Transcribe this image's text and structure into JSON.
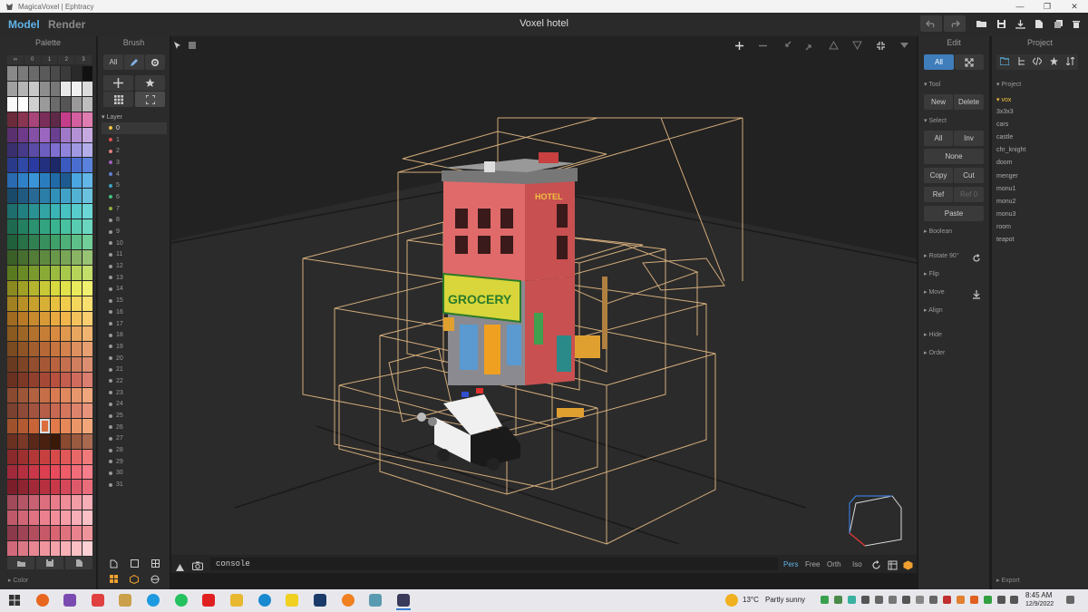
{
  "window": {
    "title": "MagicaVoxel | Ephtracy"
  },
  "header": {
    "mode_model": "Model",
    "mode_render": "Render",
    "doc_title": "Voxel hotel"
  },
  "palette": {
    "title": "Palette",
    "tabs": [
      "∞",
      "0",
      "1",
      "2",
      "3"
    ],
    "colors": [
      "#8a8a8a",
      "#7a7a7a",
      "#6a6a6a",
      "#5a5a5a",
      "#4a4a4a",
      "#3a3a3a",
      "#2a2a2a",
      "#111111",
      "#a0a0a0",
      "#b5b5b5",
      "#c8c8c8",
      "#8d8d8d",
      "#777777",
      "#e8e8e8",
      "#f0f0f0",
      "#dcdcdc",
      "#f8f8f8",
      "#ffffff",
      "#cfcfcf",
      "#9a9a9a",
      "#6b6b6b",
      "#555555",
      "#999999",
      "#bdbdbd",
      "#6b2b3b",
      "#8a3552",
      "#a8457a",
      "#7a2e5a",
      "#5e2948",
      "#c43d8a",
      "#d35f9e",
      "#e07db0",
      "#5a2f6e",
      "#6e3a8a",
      "#8450a6",
      "#9b66c0",
      "#6a3f90",
      "#a078c8",
      "#b491d4",
      "#c6a9e0",
      "#3a2f6e",
      "#483a8a",
      "#5a4ca6",
      "#6b5ec0",
      "#7e6fd0",
      "#8f84da",
      "#a098e2",
      "#b3aeea",
      "#2a3a8a",
      "#3048a6",
      "#2a3aa0",
      "#233080",
      "#1c2868",
      "#3a5ac0",
      "#4a6ed0",
      "#5a82dc",
      "#2a6ab0",
      "#3080c8",
      "#3a95d8",
      "#2a7ec0",
      "#206aa8",
      "#1e5a90",
      "#4aa6e0",
      "#62b6e8",
      "#1a4a6a",
      "#205a80",
      "#286a95",
      "#2a7ea8",
      "#3090b8",
      "#40a2c8",
      "#52b2d4",
      "#6ac2de",
      "#1e6e6e",
      "#238080",
      "#2a9292",
      "#32a4a4",
      "#3ab4b4",
      "#48c2c2",
      "#58cccc",
      "#6ad6d6",
      "#1e6a50",
      "#238060",
      "#2a9270",
      "#32a480",
      "#3ab490",
      "#48c2a0",
      "#58ccb0",
      "#6ad6c0",
      "#20603a",
      "#287046",
      "#308052",
      "#38905e",
      "#40a06a",
      "#4eb078",
      "#5ec088",
      "#70ce98",
      "#3a6028",
      "#466e30",
      "#527c38",
      "#5e8a40",
      "#6a984a",
      "#78a656",
      "#88b464",
      "#98c274",
      "#5a7a20",
      "#6a8a26",
      "#7a9a2e",
      "#8aaa36",
      "#9aba40",
      "#a8c84c",
      "#b6d45a",
      "#c4de6a",
      "#8a8a20",
      "#a0a026",
      "#b4b42e",
      "#c8c836",
      "#d8d840",
      "#e2e24c",
      "#eaea5c",
      "#f0f070",
      "#a08020",
      "#b89026",
      "#c8a02e",
      "#d8b036",
      "#e8c040",
      "#f0cc4c",
      "#f4d65c",
      "#f8e070",
      "#a06a20",
      "#b87a26",
      "#c88a2e",
      "#d89a36",
      "#e8aa40",
      "#f0b64c",
      "#f4c25c",
      "#f8ce70",
      "#8a5a20",
      "#9e6626",
      "#b2722e",
      "#c67e36",
      "#d88a40",
      "#e0984e",
      "#e8a65e",
      "#f0b470",
      "#7a4a20",
      "#8e5426",
      "#a25e2e",
      "#b66836",
      "#c87440",
      "#d4824e",
      "#de905e",
      "#e8a070",
      "#6a3a20",
      "#7e4426",
      "#924e2e",
      "#a65836",
      "#b86240",
      "#c4704e",
      "#d07e5e",
      "#dc8e70",
      "#6a3020",
      "#7e3826",
      "#92402e",
      "#a64836",
      "#b85040",
      "#c45e4e",
      "#d06c5e",
      "#dc7e70",
      "#8a4a30",
      "#9e5638",
      "#b26240",
      "#c66e48",
      "#d87a52",
      "#e0885e",
      "#e8966c",
      "#f0a67c",
      "#7a4030",
      "#8e4a38",
      "#a25440",
      "#b65e48",
      "#c86852",
      "#d4765e",
      "#de846c",
      "#e8947c",
      "#a0522d",
      "#b45a32",
      "#c86438",
      "#dc6e3e",
      "#e07a4a",
      "#e68858",
      "#ec9668",
      "#f2a67a",
      "#6a3020",
      "#7a3826",
      "#5a2818",
      "#4a2010",
      "#3a1808",
      "#8a4a30",
      "#9a5a40",
      "#aa6a50",
      "#8a2a2a",
      "#9e3030",
      "#b23838",
      "#c64040",
      "#d84a4a",
      "#e05858",
      "#e86868",
      "#f07a7a",
      "#a02a3a",
      "#b43040",
      "#c83848",
      "#dc4050",
      "#e84c5c",
      "#ee5c6a",
      "#f26c7a",
      "#f67e8a",
      "#7a1e2a",
      "#8e2430",
      "#a22a38",
      "#b63040",
      "#c83848",
      "#d4485a",
      "#de5a6a",
      "#e86c7a",
      "#a04a5a",
      "#b45666",
      "#c86272",
      "#dc6e7e",
      "#e87c8a",
      "#ee8c98",
      "#f29ca6",
      "#f6aeb6",
      "#c05a6a",
      "#d06676",
      "#e07282",
      "#ec808e",
      "#f28e9a",
      "#f69ea8",
      "#f8aeb6",
      "#fac0c6",
      "#8a3a4a",
      "#9e4454",
      "#b24e5e",
      "#c65868",
      "#d86472",
      "#e0727e",
      "#e8828c",
      "#f0949c",
      "#d06a7a",
      "#dc7886",
      "#e88692",
      "#f0949e",
      "#f4a2aa",
      "#f8b0b6",
      "#fac0c4",
      "#fcd0d4"
    ],
    "selected_index": 187,
    "footer_label": "Color"
  },
  "brush": {
    "title": "Brush",
    "filter_label": "All",
    "layer_header": "Layer",
    "layers": [
      {
        "name": "0",
        "color": "#f0c040"
      },
      {
        "name": "1",
        "color": "#e05050"
      },
      {
        "name": "2",
        "color": "#e08080"
      },
      {
        "name": "3",
        "color": "#a060c0"
      },
      {
        "name": "4",
        "color": "#6080d0"
      },
      {
        "name": "5",
        "color": "#40a0c0"
      },
      {
        "name": "6",
        "color": "#40c080"
      },
      {
        "name": "7",
        "color": "#90b040"
      },
      {
        "name": "8",
        "color": "#999999"
      },
      {
        "name": "9",
        "color": "#999999"
      },
      {
        "name": "10",
        "color": "#999999"
      },
      {
        "name": "11",
        "color": "#999999"
      },
      {
        "name": "12",
        "color": "#999999"
      },
      {
        "name": "13",
        "color": "#999999"
      },
      {
        "name": "14",
        "color": "#999999"
      },
      {
        "name": "15",
        "color": "#999999"
      },
      {
        "name": "16",
        "color": "#999999"
      },
      {
        "name": "17",
        "color": "#999999"
      },
      {
        "name": "18",
        "color": "#999999"
      },
      {
        "name": "19",
        "color": "#999999"
      },
      {
        "name": "20",
        "color": "#999999"
      },
      {
        "name": "21",
        "color": "#999999"
      },
      {
        "name": "22",
        "color": "#999999"
      },
      {
        "name": "23",
        "color": "#999999"
      },
      {
        "name": "24",
        "color": "#999999"
      },
      {
        "name": "25",
        "color": "#999999"
      },
      {
        "name": "26",
        "color": "#999999"
      },
      {
        "name": "27",
        "color": "#999999"
      },
      {
        "name": "28",
        "color": "#999999"
      },
      {
        "name": "29",
        "color": "#999999"
      },
      {
        "name": "30",
        "color": "#999999"
      },
      {
        "name": "31",
        "color": "#999999"
      }
    ]
  },
  "scene": {
    "sign_grocery": "GROCERY",
    "sign_hotel": "HOTEL"
  },
  "edit": {
    "title": "Edit",
    "filter_label": "All",
    "tool_header": "Tool",
    "new_label": "New",
    "delete_label": "Delete",
    "select_header": "Select",
    "all_label": "All",
    "inv_label": "Inv",
    "none_label": "None",
    "copy_label": "Copy",
    "cut_label": "Cut",
    "ref_label": "Ref",
    "ref0_label": "Ref 0",
    "paste_label": "Paste",
    "boolean_label": "Boolean",
    "rotate_label": "Rotate 90°",
    "flip_label": "Flip",
    "move_label": "Move",
    "align_label": "Align",
    "hide_label": "Hide",
    "order_label": "Order"
  },
  "project": {
    "title": "Project",
    "section_header": "Project",
    "folder": "vox",
    "items": [
      "3x3x3",
      "cars",
      "castle",
      "chr_knight",
      "doom",
      "menger",
      "monu1",
      "monu2",
      "monu3",
      "room",
      "teapot"
    ],
    "export_label": "Export"
  },
  "bottom": {
    "console_value": "console",
    "view_modes": [
      "Pers",
      "Free",
      "Orth",
      "Iso"
    ],
    "active_view": "Pers"
  },
  "taskbar": {
    "weather_temp": "13°C",
    "weather_text": "Partly sunny",
    "time": "8:45 AM",
    "date": "12/9/2022"
  }
}
